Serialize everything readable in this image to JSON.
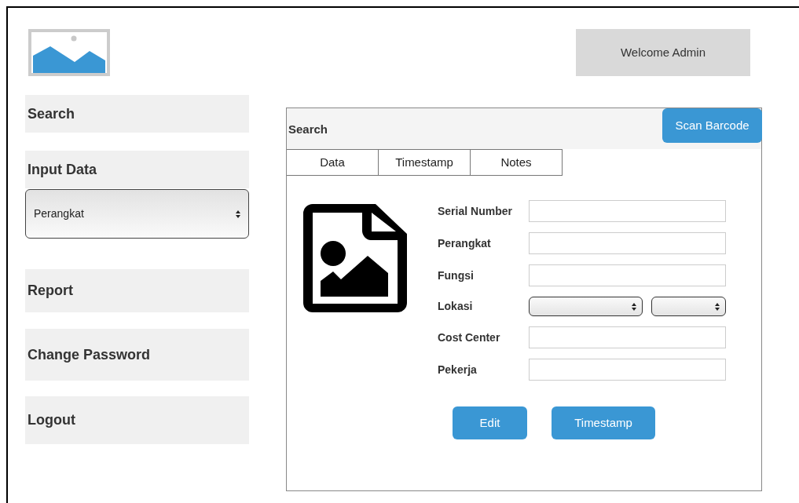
{
  "header": {
    "welcome": "Welcome Admin"
  },
  "sidebar": {
    "items": [
      {
        "label": "Search",
        "kind": "link"
      },
      {
        "label": "Input Data",
        "kind": "link"
      },
      {
        "kind": "select",
        "value": "Perangkat"
      },
      {
        "label": "Report",
        "kind": "link"
      },
      {
        "label": "Change Password",
        "kind": "link"
      },
      {
        "label": "Logout",
        "kind": "link"
      }
    ]
  },
  "panel": {
    "title": "Search",
    "scan_button": "Scan Barcode",
    "tabs": [
      {
        "label": "Data"
      },
      {
        "label": "Timestamp"
      },
      {
        "label": "Notes"
      }
    ],
    "fields": [
      {
        "label": "Serial Number",
        "kind": "text"
      },
      {
        "label": "Perangkat",
        "kind": "text"
      },
      {
        "label": "Fungsi",
        "kind": "text"
      },
      {
        "label": "Lokasi",
        "kind": "double-select"
      },
      {
        "label": "Cost Center",
        "kind": "text"
      },
      {
        "label": "Pekerja",
        "kind": "text"
      }
    ],
    "buttons": [
      "Edit",
      "Timestamp"
    ]
  }
}
